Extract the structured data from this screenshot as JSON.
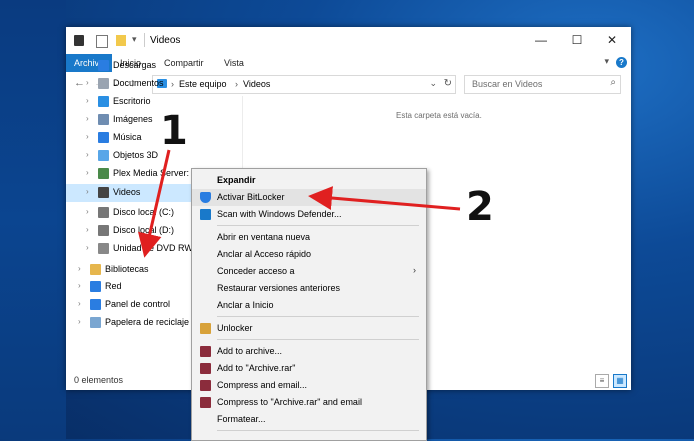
{
  "window": {
    "title": "Videos",
    "controls": {
      "minimize": "—",
      "maximize": "☐",
      "close": "✕"
    }
  },
  "ribbon": {
    "tabs": [
      {
        "label": "Archivo",
        "active": true
      },
      {
        "label": "Inicio"
      },
      {
        "label": "Compartir"
      },
      {
        "label": "Vista"
      }
    ],
    "help": "?"
  },
  "address": {
    "segments": [
      "Este equipo",
      "Videos"
    ],
    "separator": ">",
    "search_placeholder": "Buscar en Videos"
  },
  "nav_pane": {
    "items": [
      {
        "label": "Descargas",
        "icon": "download-icon",
        "color": "#2a7de1"
      },
      {
        "label": "Documentos",
        "icon": "documents-icon",
        "color": "#9aa4b1"
      },
      {
        "label": "Escritorio",
        "icon": "desktop-icon",
        "color": "#2a8fe3"
      },
      {
        "label": "Imágenes",
        "icon": "pictures-icon",
        "color": "#6f8db1"
      },
      {
        "label": "Música",
        "icon": "music-icon",
        "color": "#2a7de1"
      },
      {
        "label": "Objetos 3D",
        "icon": "3d-objects-icon",
        "color": "#58a6e8"
      },
      {
        "label": "Plex Media Server: l",
        "icon": "plex-icon",
        "color": "#4a8a4a"
      },
      {
        "label": "Videos",
        "icon": "videos-icon",
        "color": "#444",
        "selected": true
      },
      {
        "label": "Disco local (C:)",
        "icon": "drive-icon",
        "color": "#777"
      },
      {
        "label": "Disco local (D:)",
        "icon": "drive-icon",
        "color": "#777"
      },
      {
        "label": "Unidad de DVD RW",
        "icon": "dvd-icon",
        "color": "#888"
      },
      {
        "label": "Bibliotecas",
        "icon": "libraries-icon",
        "color": "#e6b64d"
      },
      {
        "label": "Red",
        "icon": "network-icon",
        "color": "#2a7de1"
      },
      {
        "label": "Panel de control",
        "icon": "control-panel-icon",
        "color": "#2a7de1"
      },
      {
        "label": "Papelera de reciclaje",
        "icon": "recycle-bin-icon",
        "color": "#7aa6d1"
      }
    ]
  },
  "content": {
    "empty_text": "Esta carpeta está vacía."
  },
  "status": {
    "count": "0 elementos"
  },
  "context_menu": {
    "items": [
      {
        "label": "Expandir",
        "bold": true
      },
      {
        "label": "Activar BitLocker",
        "icon": "shield-icon",
        "highlight": true
      },
      {
        "label": "Scan with Windows Defender...",
        "icon": "defender-icon"
      },
      {
        "sep": true
      },
      {
        "label": "Abrir en ventana nueva"
      },
      {
        "label": "Anclar al Acceso rápido"
      },
      {
        "label": "Conceder acceso a",
        "submenu": "›"
      },
      {
        "label": "Restaurar versiones anteriores"
      },
      {
        "label": "Anclar a Inicio"
      },
      {
        "sep": true
      },
      {
        "label": "Unlocker",
        "icon": "wand-icon"
      },
      {
        "sep": true
      },
      {
        "label": "Add to archive...",
        "icon": "winrar-icon"
      },
      {
        "label": "Add to \"Archive.rar\"",
        "icon": "winrar-icon"
      },
      {
        "label": "Compress and email...",
        "icon": "winrar-icon"
      },
      {
        "label": "Compress to \"Archive.rar\" and email",
        "icon": "winrar-icon"
      },
      {
        "label": "Formatear..."
      },
      {
        "sep": true
      }
    ]
  },
  "annotations": [
    {
      "number": "1",
      "color": "#e02020"
    },
    {
      "number": "2",
      "color": "#e02020"
    }
  ]
}
